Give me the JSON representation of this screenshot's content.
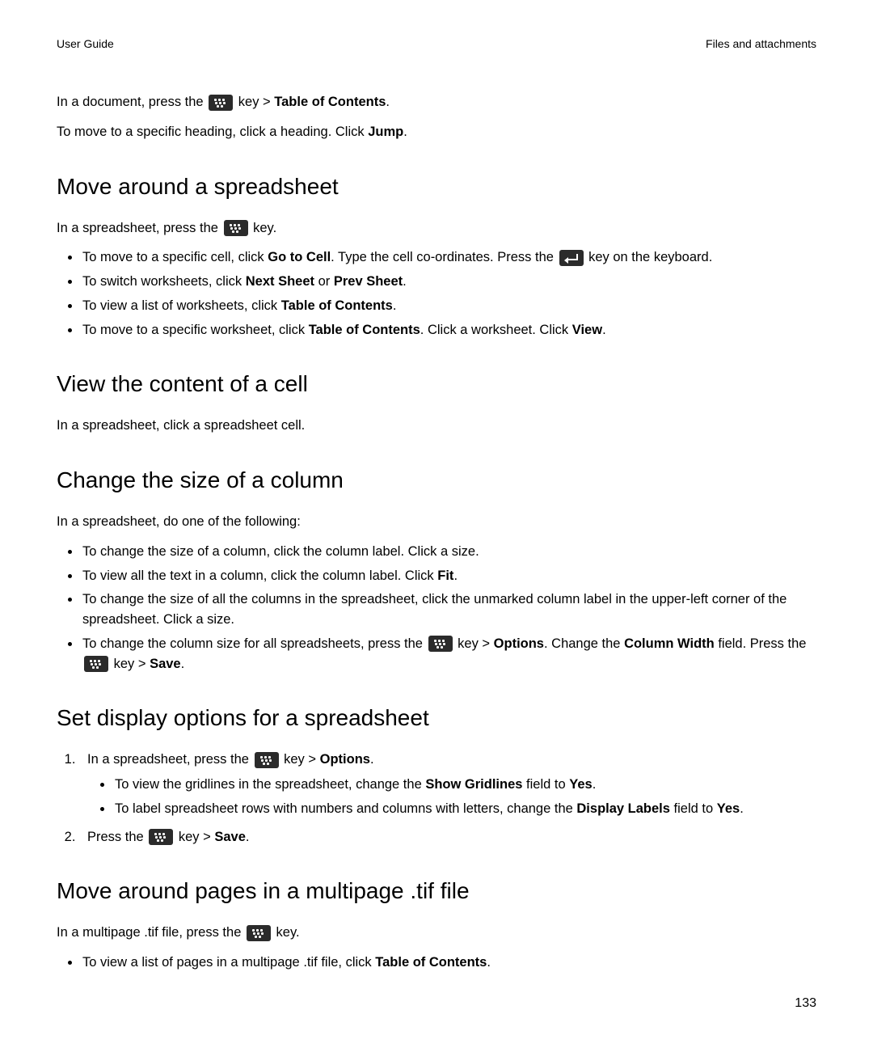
{
  "header": {
    "left": "User Guide",
    "right": "Files and attachments"
  },
  "intro": {
    "p1_a": "In a document, press the ",
    "p1_b": " key > ",
    "p1_bold": "Table of Contents",
    "p1_c": ".",
    "p2_a": "To move to a specific heading, click a heading. Click ",
    "p2_bold": "Jump",
    "p2_b": "."
  },
  "s1": {
    "title": "Move around a spreadsheet",
    "lead_a": "In a spreadsheet, press the ",
    "lead_b": " key.",
    "li1_a": "To move to a specific cell, click ",
    "li1_bold1": "Go to Cell",
    "li1_b": ". Type the cell co-ordinates. Press the ",
    "li1_c": " key on the keyboard.",
    "li2_a": "To switch worksheets, click ",
    "li2_bold1": "Next Sheet",
    "li2_b": " or ",
    "li2_bold2": "Prev Sheet",
    "li2_c": ".",
    "li3_a": "To view a list of worksheets, click ",
    "li3_bold1": "Table of Contents",
    "li3_b": ".",
    "li4_a": "To move to a specific worksheet, click ",
    "li4_bold1": "Table of Contents",
    "li4_b": ". Click a worksheet. Click ",
    "li4_bold2": "View",
    "li4_c": "."
  },
  "s2": {
    "title": "View the content of a cell",
    "p": "In a spreadsheet, click a spreadsheet cell."
  },
  "s3": {
    "title": "Change the size of a column",
    "lead": "In a spreadsheet, do one of the following:",
    "li1": "To change the size of a column, click the column label. Click a size.",
    "li2_a": "To view all the text in a column, click the column label. Click ",
    "li2_bold": "Fit",
    "li2_b": ".",
    "li3": "To change the size of all the columns in the spreadsheet, click the unmarked column label in the upper-left corner of the spreadsheet. Click a size.",
    "li4_a": "To change the column size for all spreadsheets, press the ",
    "li4_b": " key > ",
    "li4_bold1": "Options",
    "li4_c": ". Change the ",
    "li4_bold2": "Column Width",
    "li4_d": " field. Press the ",
    "li4_e": " key > ",
    "li4_bold3": "Save",
    "li4_f": "."
  },
  "s4": {
    "title": "Set display options for a spreadsheet",
    "li1_a": "In a spreadsheet, press the ",
    "li1_b": " key > ",
    "li1_bold": "Options",
    "li1_c": ".",
    "sub1_a": "To view the gridlines in the spreadsheet, change the ",
    "sub1_bold1": "Show Gridlines",
    "sub1_b": " field to ",
    "sub1_bold2": "Yes",
    "sub1_c": ".",
    "sub2_a": "To label spreadsheet rows with numbers and columns with letters, change the ",
    "sub2_bold1": "Display Labels",
    "sub2_b": " field to ",
    "sub2_bold2": "Yes",
    "sub2_c": ".",
    "li2_a": "Press the ",
    "li2_b": " key > ",
    "li2_bold": "Save",
    "li2_c": "."
  },
  "s5": {
    "title": "Move around pages in a multipage .tif file",
    "lead_a": "In a multipage .tif file, press the ",
    "lead_b": " key.",
    "li1_a": "To view a list of pages in a multipage .tif file, click ",
    "li1_bold": "Table of Contents",
    "li1_b": "."
  },
  "page_number": "133"
}
